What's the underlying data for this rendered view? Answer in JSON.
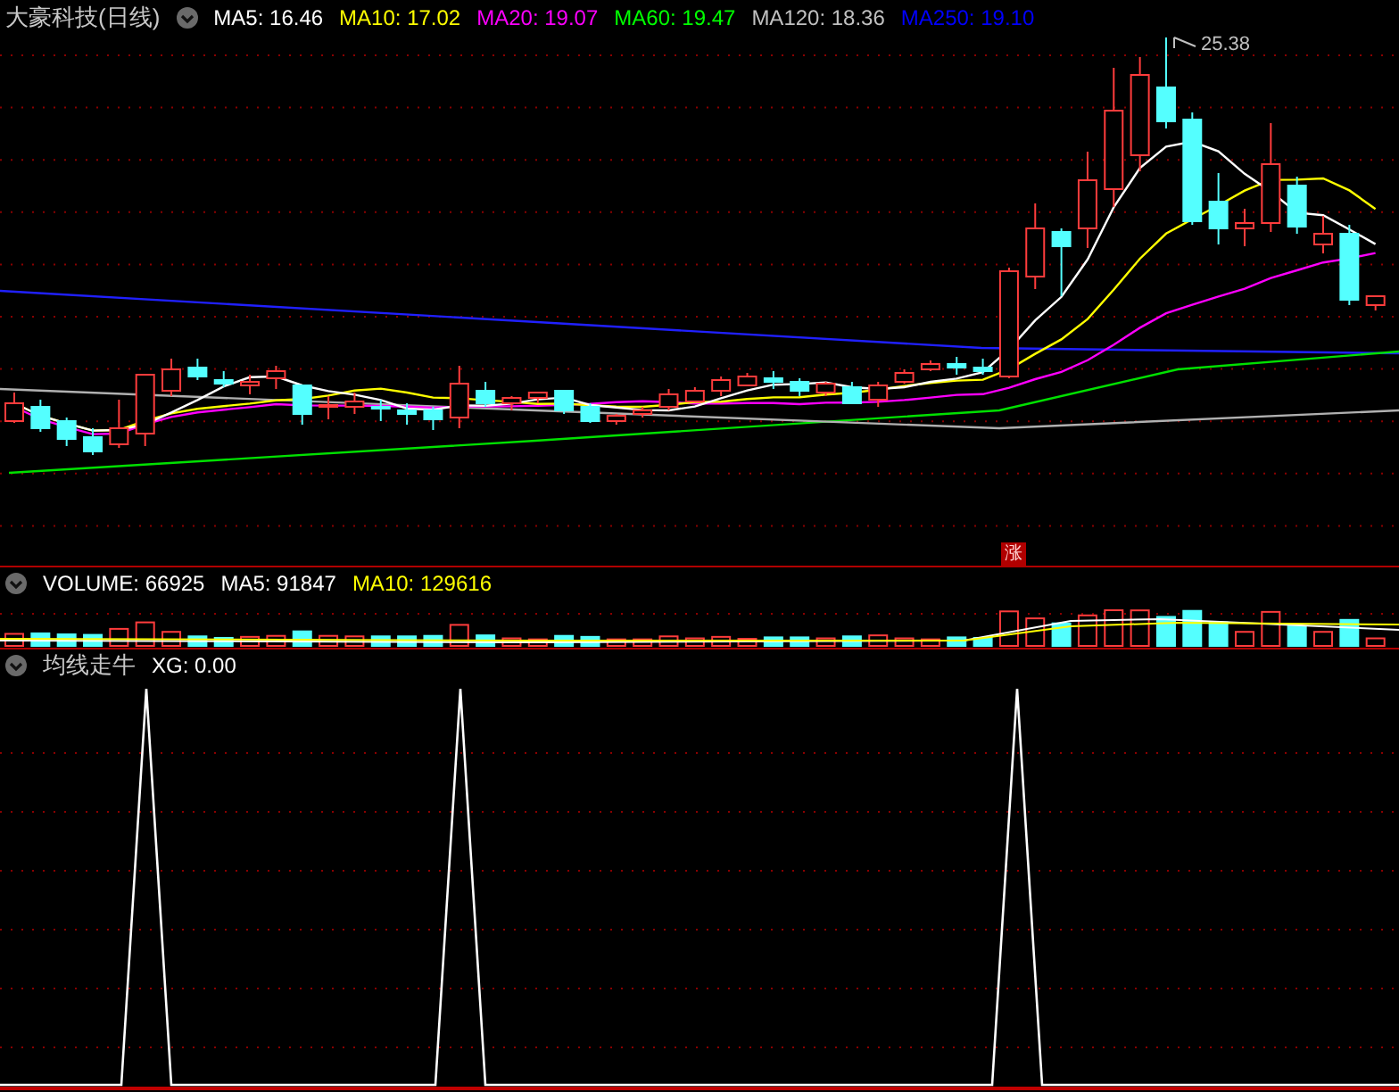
{
  "main_panel": {
    "title": "大豪科技(日线)",
    "indicators": [
      {
        "text": "MA5: 16.46",
        "color": "#ffffff"
      },
      {
        "text": "MA10: 17.02",
        "color": "#ffff00"
      },
      {
        "text": "MA20: 19.07",
        "color": "#ff00ff"
      },
      {
        "text": "MA60: 19.47",
        "color": "#00ff00"
      },
      {
        "text": "MA120: 18.36",
        "color": "#c0c0c0"
      },
      {
        "text": "MA250: 19.10",
        "color": "#0000ff"
      }
    ],
    "high_label": "25.38",
    "signal_badge": "涨"
  },
  "volume_panel": {
    "indicators": [
      {
        "text": "VOLUME: 66925",
        "color": "#ffffff"
      },
      {
        "text": "MA5: 91847",
        "color": "#ffffff"
      },
      {
        "text": "MA10: 129616",
        "color": "#ffff00"
      }
    ]
  },
  "signal_panel": {
    "title": "均线走牛",
    "indicators": [
      {
        "text": "XG: 0.00",
        "color": "#ffffff"
      }
    ]
  }
}
